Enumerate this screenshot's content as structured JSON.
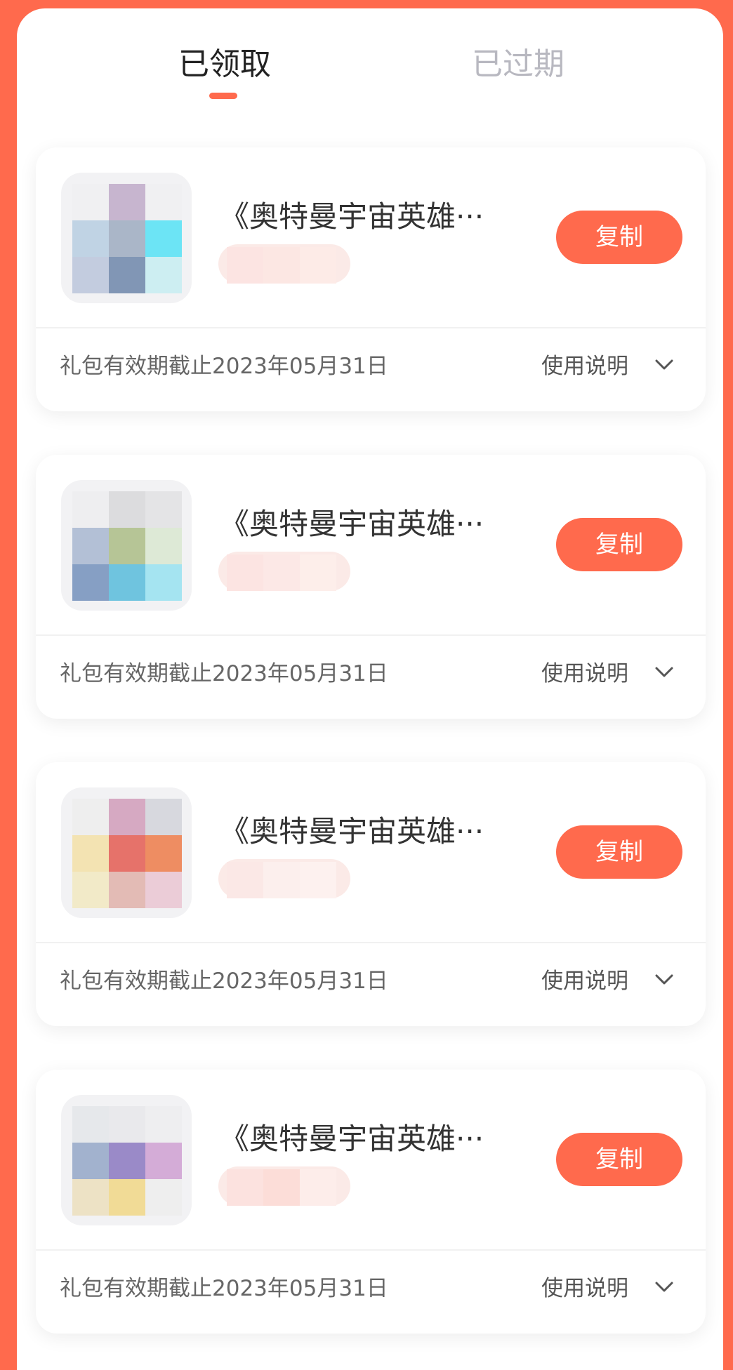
{
  "tabs": {
    "active_label": "已领取",
    "inactive_label": "已过期"
  },
  "gifts": [
    {
      "title": "《奥特曼宇宙英雄···",
      "copy_label": "复制",
      "expiry": "礼包有效期截止2023年05月31日",
      "instructions_label": "使用说明",
      "thumb_colors": [
        "#F0F0F2",
        "#C7B5CF",
        "#F0F0F2",
        "#C0D3E4",
        "#AAB6C8",
        "#6CE4F5",
        "#C3CCDF",
        "#8196B5",
        "#CDEEF2"
      ],
      "sub_colors": [
        "#FCE4E2",
        "#FCE7E3",
        "#FDEBE7"
      ]
    },
    {
      "title": "《奥特曼宇宙英雄···",
      "copy_label": "复制",
      "expiry": "礼包有效期截止2023年05月31日",
      "instructions_label": "使用说明",
      "thumb_colors": [
        "#EEEEF0",
        "#DCDCDE",
        "#E4E4E6",
        "#B3C0D6",
        "#B6C596",
        "#DDE9D6",
        "#869FC4",
        "#6FC4DF",
        "#A5E4F1"
      ],
      "sub_colors": [
        "#FCE4E2",
        "#FCE8E6",
        "#FDEEEA"
      ]
    },
    {
      "title": "《奥特曼宇宙英雄···",
      "copy_label": "复制",
      "expiry": "礼包有效期截止2023年05月31日",
      "instructions_label": "使用说明",
      "thumb_colors": [
        "#EEEEEE",
        "#D6A9C2",
        "#D7D8DE",
        "#F3E3B2",
        "#E6726A",
        "#EE8D62",
        "#F2EAC8",
        "#E3BBB5",
        "#EBCCD7"
      ],
      "sub_colors": [
        "#FBE8E6",
        "#FCEFED",
        "#FDF1EF"
      ]
    },
    {
      "title": "《奥特曼宇宙英雄···",
      "copy_label": "复制",
      "expiry": "礼包有效期截止2023年05月31日",
      "instructions_label": "使用说明",
      "thumb_colors": [
        "#E6E8EB",
        "#E9E9EC",
        "#EEEEF0",
        "#A2B2CE",
        "#9A8AC8",
        "#D4ACD7",
        "#EDE2C5",
        "#F1DB96",
        "#EEEEEE"
      ],
      "sub_colors": [
        "#FCE2DF",
        "#FCDDD8",
        "#FDEDEA"
      ]
    }
  ]
}
